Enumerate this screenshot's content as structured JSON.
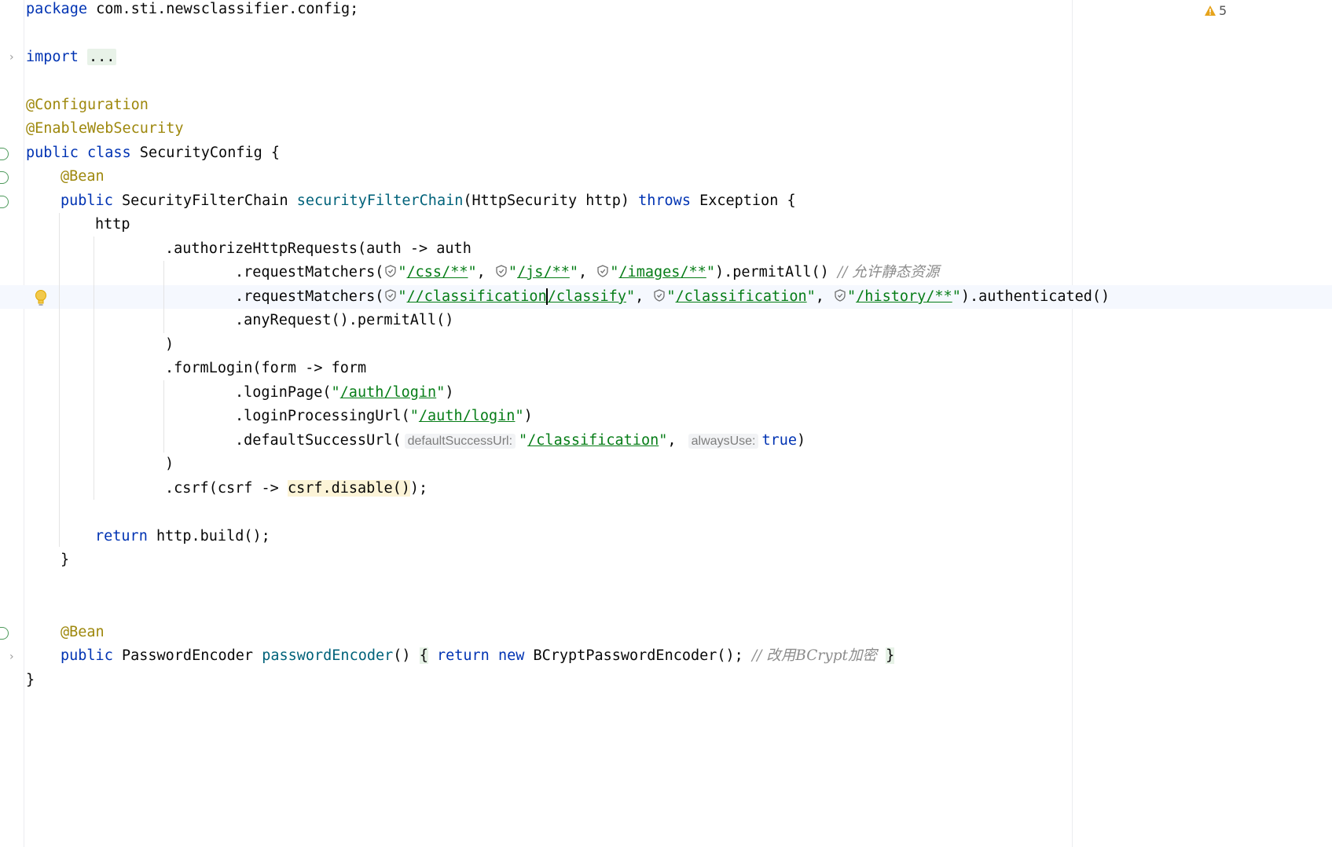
{
  "editor": {
    "warnings_count": "5",
    "lines": {
      "l1": {
        "kw": "package",
        "rest": " com.sti.newsclassifier.config;"
      },
      "l2": {
        "kw": "import",
        "fold": "..."
      },
      "l3": {
        "ann": "@Configuration"
      },
      "l4": {
        "ann": "@EnableWebSecurity"
      },
      "l5": {
        "kw1": "public",
        "kw2": "class",
        "rest": " SecurityConfig {"
      },
      "l6": {
        "ann": "@Bean"
      },
      "l7": {
        "kw1": "public",
        "type": " SecurityFilterChain ",
        "fn": "securityFilterChain",
        "params": "(HttpSecurity http) ",
        "kw2": "throws",
        "rest": " Exception {"
      },
      "l8": {
        "text": "http"
      },
      "l9": {
        "text": ".authorizeHttpRequests(auth -> auth"
      },
      "l10": {
        "prefix": ".requestMatchers(",
        "s1": "/css/**",
        "s2": "/js/**",
        "s3": "/images/**",
        "suffix": ").permitAll() ",
        "comment": "// 允许静态资源"
      },
      "l11": {
        "prefix": ".requestMatchers(",
        "s1a": "//classification",
        "s1b": "/classify",
        "s2": "/classification",
        "s3": "/history/**",
        "suffix": ").authenticated()"
      },
      "l12": {
        "text": ".anyRequest().permitAll()"
      },
      "l13": {
        "text": ")"
      },
      "l14": {
        "text": ".formLogin(form -> form"
      },
      "l15": {
        "prefix": ".loginPage(",
        "s": "/auth/login",
        "suffix": ")"
      },
      "l16": {
        "prefix": ".loginProcessingUrl(",
        "s": "/auth/login",
        "suffix": ")"
      },
      "l17": {
        "prefix": ".defaultSuccessUrl(",
        "hint1": "defaultSuccessUrl:",
        "s": "/classification",
        "hint2": "alwaysUse:",
        "kw": "true",
        "suffix": ")"
      },
      "l18": {
        "text": ")"
      },
      "l19": {
        "prefix": ".csrf(csrf -> ",
        "warn": "csrf.disable()",
        "suffix": ");"
      },
      "l20": {
        "kw": "return",
        "rest": " http.build();"
      },
      "l21": {
        "text": "}"
      },
      "l22": {
        "ann": "@Bean"
      },
      "l23": {
        "kw1": "public",
        "type": " PasswordEncoder ",
        "fn": "passwordEncoder",
        "paren": "() ",
        "open": "{",
        "kw2": "return",
        "kw3": "new",
        "rest": " BCryptPasswordEncoder(); ",
        "comment": "// 改用BCrypt加密",
        "close": "}"
      },
      "l24": {
        "text": "}"
      }
    }
  }
}
